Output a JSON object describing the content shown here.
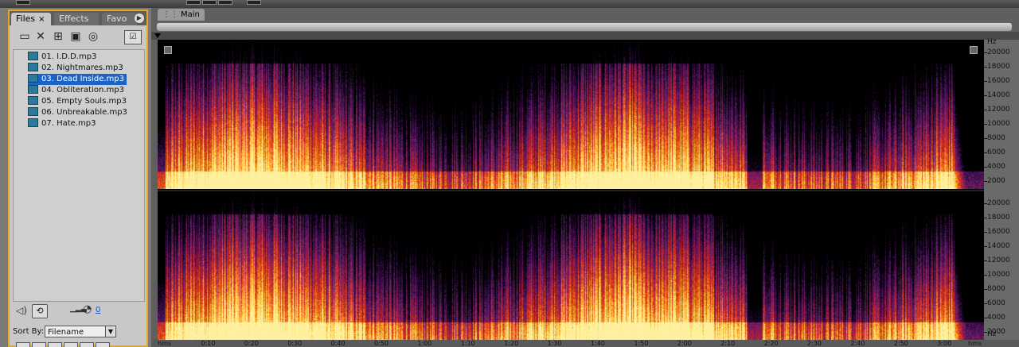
{
  "panel": {
    "tabs": [
      {
        "label": "Files",
        "close": "×"
      },
      {
        "label": "Effects"
      },
      {
        "label": "Favo"
      }
    ],
    "tab_menu_icon": "▶",
    "toolbar_icons": [
      "open-file-icon",
      "close-file-icon",
      "import-icon",
      "import-all-icon",
      "autoplay-icon",
      "show-options-icon"
    ],
    "files": [
      {
        "name": "01. I.D.D.mp3"
      },
      {
        "name": "02. Nightmares.mp3"
      },
      {
        "name": "03. Dead Inside.mp3",
        "selected": true
      },
      {
        "name": "04. Obliteration.mp3"
      },
      {
        "name": "05. Empty Souls.mp3"
      },
      {
        "name": "06. Unbreakable.mp3"
      },
      {
        "name": "07. Hate.mp3"
      }
    ],
    "loop_value": "0",
    "sort_by_label": "Sort By:",
    "sort_by_value": "Filename"
  },
  "editor": {
    "tab_label": "Main",
    "hz_unit": "Hz",
    "hz_ticks": [
      "20000",
      "18000",
      "16000",
      "14000",
      "12000",
      "10000",
      "8000",
      "6000",
      "4000",
      "2000"
    ],
    "time_ticks": [
      "hms",
      "0:10",
      "0:20",
      "0:30",
      "0:40",
      "0:50",
      "1:00",
      "1:10",
      "1:20",
      "1:30",
      "1:40",
      "1:50",
      "2:00",
      "2:10",
      "2:20",
      "2:30",
      "2:40",
      "2:50",
      "3:00",
      "hms"
    ],
    "spectrum_colors": [
      "#000000",
      "#2a0a3a",
      "#5a1a6a",
      "#a01a4a",
      "#d8301a",
      "#f07a18",
      "#ffd040",
      "#fff0a0"
    ]
  }
}
